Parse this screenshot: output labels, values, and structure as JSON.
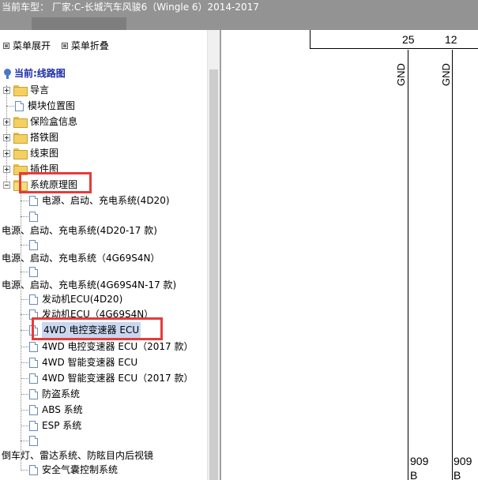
{
  "header": {
    "title": "当前车型：  厂家:C-长城汽车风骏6（Wingle 6）2014-2017"
  },
  "toolbar": {
    "expand_label": "菜单展开",
    "collapse_label": "菜单折叠"
  },
  "tree": {
    "current_label": "当前:线路图",
    "items": [
      {
        "label": "导言"
      },
      {
        "label": "模块位置图"
      },
      {
        "label": "保险盒信息"
      },
      {
        "label": "搭铁图"
      },
      {
        "label": "线束图"
      },
      {
        "label": "插件图"
      },
      {
        "label": "系统原理图"
      },
      {
        "label": "电源、启动、充电系统(4D20)"
      },
      {
        "label": "电源、启动、充电系统(4D20-17 款)"
      },
      {
        "label": "电源、启动、充电系统（4G69S4N）"
      },
      {
        "label": "电源、启动、充电系统(4G69S4N-17 款)"
      },
      {
        "label": "发动机ECU(4D20)"
      },
      {
        "label": "发动机ECU（4G69S4N）"
      },
      {
        "label": "4WD 电控变速器 ECU"
      },
      {
        "label": "4WD 电控变速器 ECU（2017 款）"
      },
      {
        "label": "4WD 智能变速器 ECU"
      },
      {
        "label": "4WD 智能变速器 ECU（2017 款）"
      },
      {
        "label": "防盗系统"
      },
      {
        "label": "ABS 系统"
      },
      {
        "label": "ESP 系统"
      },
      {
        "label": "倒车灯、雷达系统、防眩目内后视镜"
      },
      {
        "label": "安全气囊控制系统"
      }
    ]
  },
  "diagram": {
    "pins": [
      "25",
      "12"
    ],
    "gnd_labels": [
      "GND",
      "GND"
    ],
    "wire_numbers": [
      "909",
      "909"
    ],
    "wire_colors": [
      "B",
      "B"
    ]
  }
}
